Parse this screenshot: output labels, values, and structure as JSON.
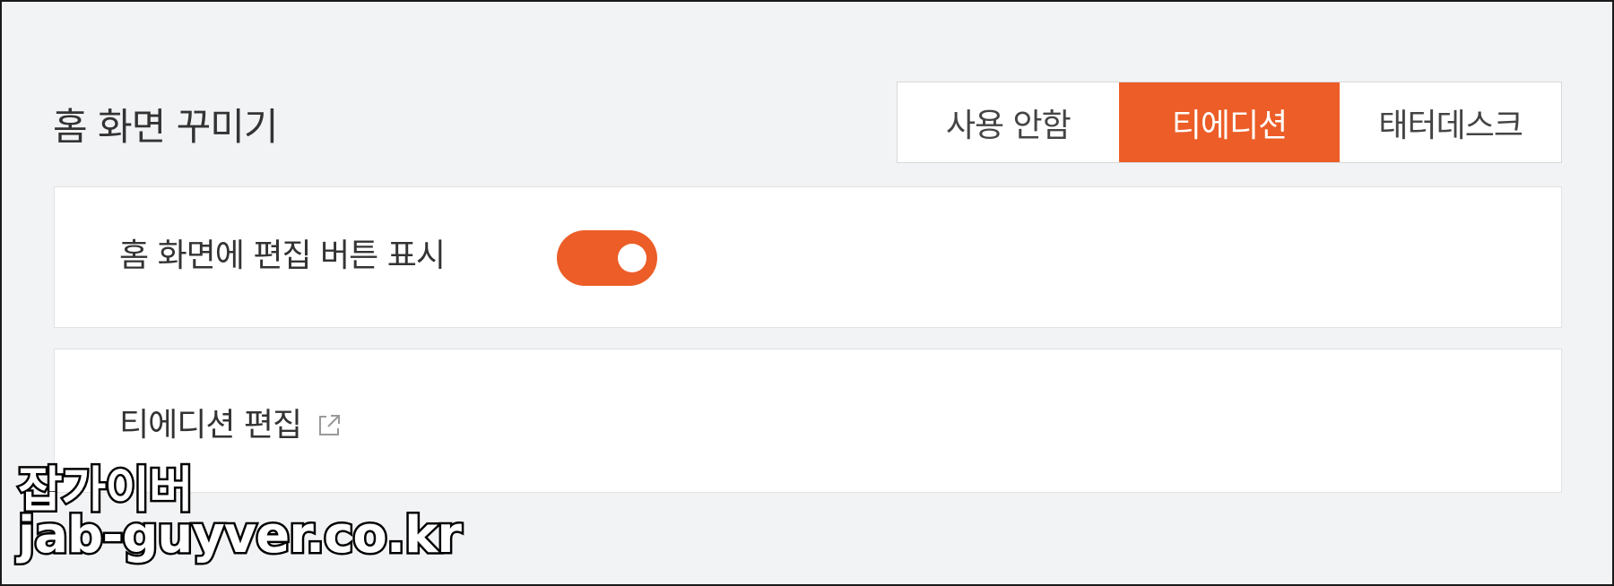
{
  "section": {
    "title": "홈 화면 꾸미기"
  },
  "mode_selector": {
    "options": [
      "사용 안함",
      "티에디션",
      "태터데스크"
    ],
    "selected": "티에디션"
  },
  "settings": {
    "show_edit_button": {
      "label": "홈 화면에 편집 버튼 표시",
      "enabled": true
    },
    "edit_link": {
      "label": "티에디션 편집",
      "icon": "external-link-icon"
    }
  },
  "watermark": {
    "line1": "잡가이버",
    "line2": "jab-guyver.co.kr"
  },
  "colors": {
    "accent": "#ec5d27",
    "background": "#f2f3f5",
    "card": "#ffffff",
    "text": "#333333"
  }
}
